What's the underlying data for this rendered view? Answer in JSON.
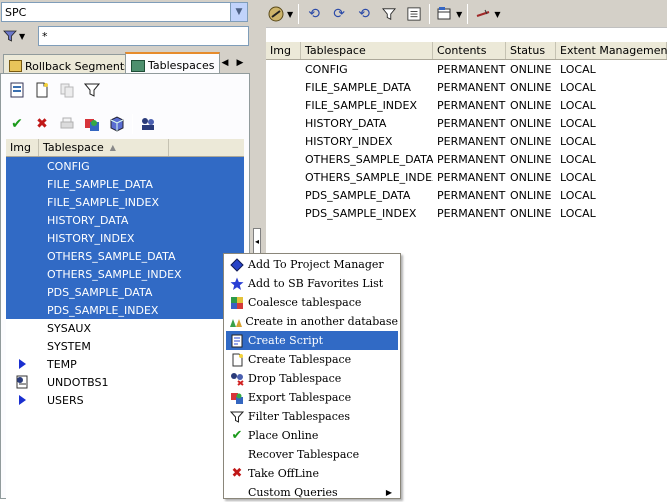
{
  "schema_combo": {
    "value": "SPC"
  },
  "filter": {
    "value": "*"
  },
  "tabs": [
    {
      "label": "Rollback Segments",
      "icon": "rollback-segments-icon",
      "active": false
    },
    {
      "label": "Tablespaces",
      "icon": "tablespaces-icon",
      "active": true
    }
  ],
  "left_grid": {
    "headers": {
      "img": "Img",
      "tablespace": "Tablespace"
    },
    "rows": [
      {
        "name": "CONFIG",
        "selected": true,
        "icon": ""
      },
      {
        "name": "FILE_SAMPLE_DATA",
        "selected": true,
        "icon": ""
      },
      {
        "name": "FILE_SAMPLE_INDEX",
        "selected": true,
        "icon": ""
      },
      {
        "name": "HISTORY_DATA",
        "selected": true,
        "icon": ""
      },
      {
        "name": "HISTORY_INDEX",
        "selected": true,
        "icon": ""
      },
      {
        "name": "OTHERS_SAMPLE_DATA",
        "selected": true,
        "icon": ""
      },
      {
        "name": "OTHERS_SAMPLE_INDEX",
        "selected": true,
        "icon": ""
      },
      {
        "name": "PDS_SAMPLE_DATA",
        "selected": true,
        "icon": ""
      },
      {
        "name": "PDS_SAMPLE_INDEX",
        "selected": true,
        "icon": ""
      },
      {
        "name": "SYSAUX",
        "selected": false,
        "icon": ""
      },
      {
        "name": "SYSTEM",
        "selected": false,
        "icon": ""
      },
      {
        "name": "TEMP",
        "selected": false,
        "icon": "temp-marker-icon"
      },
      {
        "name": "UNDOTBS1",
        "selected": false,
        "icon": "undo-icon"
      },
      {
        "name": "USERS",
        "selected": false,
        "icon": "users-marker-icon"
      }
    ]
  },
  "right_grid": {
    "headers": {
      "img": "Img",
      "tablespace": "Tablespace",
      "contents": "Contents",
      "status": "Status",
      "extent": "Extent Management"
    },
    "rows": [
      {
        "tablespace": "CONFIG",
        "contents": "PERMANENT",
        "status": "ONLINE",
        "extent": "LOCAL"
      },
      {
        "tablespace": "FILE_SAMPLE_DATA",
        "contents": "PERMANENT",
        "status": "ONLINE",
        "extent": "LOCAL"
      },
      {
        "tablespace": "FILE_SAMPLE_INDEX",
        "contents": "PERMANENT",
        "status": "ONLINE",
        "extent": "LOCAL"
      },
      {
        "tablespace": "HISTORY_DATA",
        "contents": "PERMANENT",
        "status": "ONLINE",
        "extent": "LOCAL"
      },
      {
        "tablespace": "HISTORY_INDEX",
        "contents": "PERMANENT",
        "status": "ONLINE",
        "extent": "LOCAL"
      },
      {
        "tablespace": "OTHERS_SAMPLE_DATA",
        "contents": "PERMANENT",
        "status": "ONLINE",
        "extent": "LOCAL"
      },
      {
        "tablespace": "OTHERS_SAMPLE_INDEX",
        "contents": "PERMANENT",
        "status": "ONLINE",
        "extent": "LOCAL"
      },
      {
        "tablespace": "PDS_SAMPLE_DATA",
        "contents": "PERMANENT",
        "status": "ONLINE",
        "extent": "LOCAL"
      },
      {
        "tablespace": "PDS_SAMPLE_INDEX",
        "contents": "PERMANENT",
        "status": "ONLINE",
        "extent": "LOCAL"
      }
    ]
  },
  "context_menu": {
    "items": [
      {
        "label": "Add To Project Manager",
        "icon": "project-manager-icon",
        "highlighted": false,
        "submenu": false
      },
      {
        "label": "Add to SB Favorites List",
        "icon": "favorites-star-icon",
        "highlighted": false,
        "submenu": false
      },
      {
        "label": "Coalesce tablespace",
        "icon": "coalesce-icon",
        "highlighted": false,
        "submenu": false
      },
      {
        "label": "Create in another database",
        "icon": "create-another-db-icon",
        "highlighted": false,
        "submenu": false
      },
      {
        "label": "Create Script",
        "icon": "create-script-icon",
        "highlighted": true,
        "submenu": false
      },
      {
        "label": "Create Tablespace",
        "icon": "new-document-icon",
        "highlighted": false,
        "submenu": false
      },
      {
        "label": "Drop Tablespace",
        "icon": "drop-icon",
        "highlighted": false,
        "submenu": false
      },
      {
        "label": "Export Tablespace",
        "icon": "export-icon",
        "highlighted": false,
        "submenu": false
      },
      {
        "label": "Filter Tablespaces",
        "icon": "filter-icon",
        "highlighted": false,
        "submenu": false
      },
      {
        "label": "Place Online",
        "icon": "checkmark-icon",
        "highlighted": false,
        "submenu": false
      },
      {
        "label": "Recover Tablespace",
        "icon": "",
        "highlighted": false,
        "submenu": false
      },
      {
        "label": "Take OffLine",
        "icon": "red-x-icon",
        "highlighted": false,
        "submenu": false
      },
      {
        "label": "Custom Queries",
        "icon": "",
        "highlighted": false,
        "submenu": true
      }
    ]
  },
  "colors": {
    "selection": "#316ac5",
    "toolbar_bg": "#d4d0c8",
    "tab_accent": "#e68b2c",
    "grid_header": "#ece9d8"
  }
}
